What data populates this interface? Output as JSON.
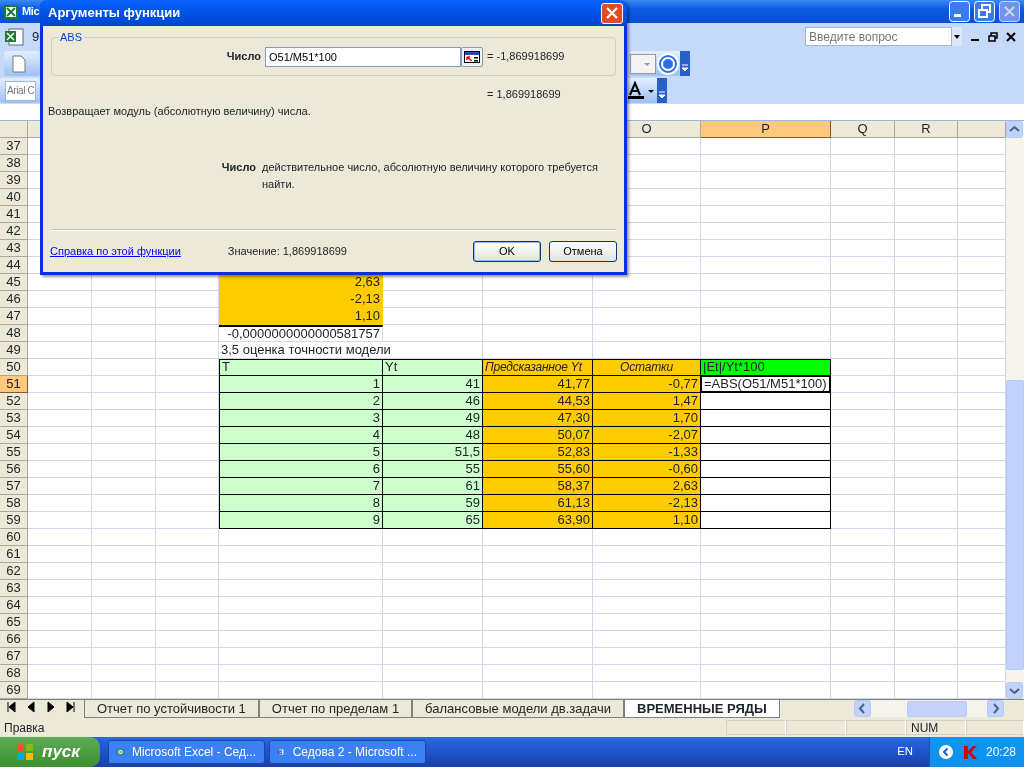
{
  "window": {
    "title": "Mic"
  },
  "help_field": {
    "placeholder": "Введите вопрос"
  },
  "toolbar": {
    "fragment": "9",
    "font_field": "Arial C"
  },
  "dialog": {
    "title": "Аргументы функции",
    "group": "ABS",
    "argument": {
      "label": "Число",
      "value": "O51/M51*100",
      "result": "= -1,869918699"
    },
    "function_result": "= 1,869918699",
    "description": "Возвращает модуль (абсолютную величину) числа.",
    "argument_help": {
      "label": "Число",
      "text": "действительное число, абсолютную величину которого требуется найти."
    },
    "help_link": "Справка по этой функции",
    "value_text": "Значение: 1,869918699",
    "buttons": [
      "OK",
      "Отмена"
    ]
  },
  "column_headers": [
    {
      "label": "O",
      "selected": false
    },
    {
      "label": "P",
      "selected": true
    },
    {
      "label": "Q",
      "selected": false
    },
    {
      "label": "R",
      "selected": false
    }
  ],
  "row_headers": [
    {
      "label": "37",
      "selected": false
    },
    {
      "label": "38",
      "selected": false
    },
    {
      "label": "39",
      "selected": false
    },
    {
      "label": "40",
      "selected": false
    },
    {
      "label": "41",
      "selected": false
    },
    {
      "label": "42",
      "selected": false
    },
    {
      "label": "43",
      "selected": false
    },
    {
      "label": "44",
      "selected": false
    },
    {
      "label": "45",
      "selected": false
    },
    {
      "label": "46",
      "selected": false
    },
    {
      "label": "47",
      "selected": false
    },
    {
      "label": "48",
      "selected": false
    },
    {
      "label": "49",
      "selected": false
    },
    {
      "label": "50",
      "selected": false
    },
    {
      "label": "51",
      "selected": true
    },
    {
      "label": "52",
      "selected": false
    },
    {
      "label": "53",
      "selected": false
    },
    {
      "label": "54",
      "selected": false
    },
    {
      "label": "55",
      "selected": false
    },
    {
      "label": "56",
      "selected": false
    },
    {
      "label": "57",
      "selected": false
    },
    {
      "label": "58",
      "selected": false
    },
    {
      "label": "59",
      "selected": false
    },
    {
      "label": "60",
      "selected": false
    },
    {
      "label": "61",
      "selected": false
    },
    {
      "label": "62",
      "selected": false
    },
    {
      "label": "63",
      "selected": false
    },
    {
      "label": "64",
      "selected": false
    },
    {
      "label": "65",
      "selected": false
    },
    {
      "label": "66",
      "selected": false
    },
    {
      "label": "67",
      "selected": false
    },
    {
      "label": "68",
      "selected": false
    },
    {
      "label": "69",
      "selected": false
    }
  ],
  "residual_cells": [
    "2,63",
    "-2,13",
    "1,10"
  ],
  "sum_cell": "-0,0000000000000581757",
  "section_title": "3,5 оценка точности модели",
  "table": {
    "columns": [
      {
        "label": "T",
        "kind": "input"
      },
      {
        "label": "Yt",
        "kind": "input"
      },
      {
        "label": "Предсказанное Yt",
        "kind": "computed"
      },
      {
        "label": "Остатки",
        "kind": "computed"
      },
      {
        "label": "|Et|/Yt*100",
        "kind": "result"
      }
    ],
    "rows": [
      {
        "cells": [
          "1",
          "41",
          "41,77",
          "-0,77"
        ],
        "formula": "=ABS(O51/M51*100)"
      },
      {
        "cells": [
          "2",
          "46",
          "44,53",
          "1,47"
        ]
      },
      {
        "cells": [
          "3",
          "49",
          "47,30",
          "1,70"
        ]
      },
      {
        "cells": [
          "4",
          "48",
          "50,07",
          "-2,07"
        ]
      },
      {
        "cells": [
          "5",
          "51,5",
          "52,83",
          "-1,33"
        ]
      },
      {
        "cells": [
          "6",
          "55",
          "55,60",
          "-0,60"
        ]
      },
      {
        "cells": [
          "7",
          "61",
          "58,37",
          "2,63"
        ]
      },
      {
        "cells": [
          "8",
          "59",
          "61,13",
          "-2,13"
        ]
      },
      {
        "cells": [
          "9",
          "65",
          "63,90",
          "1,10"
        ]
      }
    ]
  },
  "sheet_tabs": [
    {
      "label": "Отчет по устойчивости 1",
      "selected": false
    },
    {
      "label": "Отчет по пределам 1",
      "selected": false
    },
    {
      "label": "балансовые модели дв.задачи",
      "selected": false
    },
    {
      "label": "ВРЕМЕННЫЕ РЯДЫ",
      "selected": true
    }
  ],
  "status_bar": {
    "mode": "Правка",
    "indicator": "NUM"
  },
  "taskbar": {
    "start": "пуск",
    "tasks": [
      "Microsoft Excel - Сед...",
      "Седова 2 - Microsoft ..."
    ],
    "language": "EN",
    "clock": "20:28"
  }
}
